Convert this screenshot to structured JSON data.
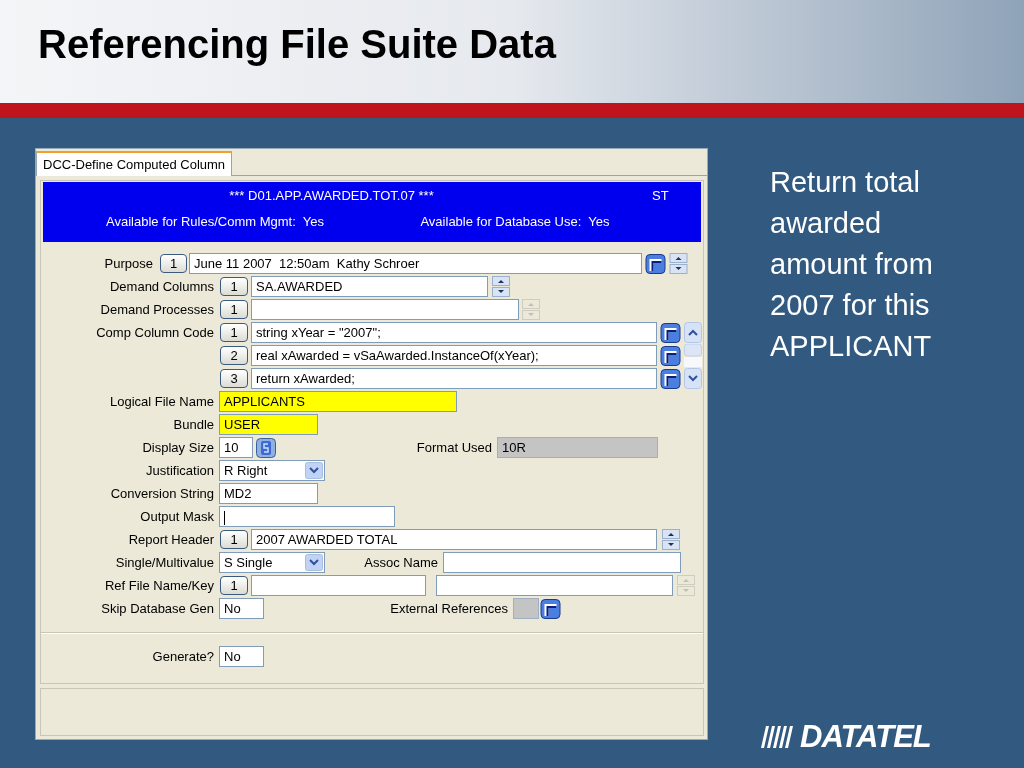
{
  "slide": {
    "title": "Referencing File Suite Data",
    "note": "Return total awarded amount from 2007 for this APPLICANT",
    "logo": "DATATEL"
  },
  "window": {
    "tabs": [
      {
        "label": "DCC-Define Computed Column",
        "selected": true
      }
    ],
    "header": {
      "record": "*** D01.APP.AWARDED.TOT.07 ***",
      "code": "ST",
      "rules": "Available for Rules/Comm Mgmt:  Yes",
      "database": "Available for Database Use:  Yes"
    },
    "rows": [
      {
        "parts": [
          {
            "kind": "label",
            "text": "Purpose"
          },
          {
            "kind": "index",
            "text": "1"
          },
          {
            "kind": "field",
            "value": "June 11 2007  12:50am  Kathy Schroer",
            "highlighted": false,
            "focused": false
          },
          {
            "kind": "lookup"
          },
          {
            "kind": "spinner",
            "disabled": false
          }
        ]
      },
      {
        "parts": [
          {
            "kind": "label",
            "text": "Demand Columns"
          },
          {
            "kind": "index",
            "text": "1"
          },
          {
            "kind": "field",
            "value": "SA.AWARDED",
            "highlighted": false,
            "focused": false
          },
          {
            "kind": "spinner",
            "disabled": false
          }
        ]
      },
      {
        "parts": [
          {
            "kind": "label",
            "text": "Demand Processes"
          },
          {
            "kind": "index",
            "text": "1"
          },
          {
            "kind": "field",
            "highlighted": false,
            "focused": false
          },
          {
            "kind": "spinner",
            "disabled": true
          }
        ]
      },
      {
        "parts": [
          {
            "kind": "label",
            "text": "Comp Column Code"
          },
          {
            "kind": "index",
            "text": "1"
          },
          {
            "kind": "field",
            "value": "string xYear = \"2007\";",
            "highlighted": false,
            "focused": false
          },
          {
            "kind": "lookup"
          },
          {
            "kind": "scroll-up"
          }
        ]
      },
      {
        "parts": [
          {
            "kind": "index",
            "text": "2"
          },
          {
            "kind": "field",
            "value": "real xAwarded = vSaAwarded.InstanceOf(xYear);",
            "highlighted": false,
            "focused": false
          },
          {
            "kind": "lookup"
          },
          {
            "kind": "scroll-track"
          }
        ]
      },
      {
        "parts": [
          {
            "kind": "index",
            "text": "3"
          },
          {
            "kind": "field",
            "value": "return xAwarded;",
            "highlighted": false,
            "focused": false
          },
          {
            "kind": "lookup"
          },
          {
            "kind": "scroll-down"
          }
        ]
      },
      {
        "parts": [
          {
            "kind": "label",
            "text": "Logical File Name"
          },
          {
            "kind": "field",
            "value": "APPLICANTS",
            "highlighted": true,
            "focused": false
          }
        ]
      },
      {
        "parts": [
          {
            "kind": "label",
            "text": "Bundle"
          },
          {
            "kind": "field",
            "value": "USER",
            "highlighted": true,
            "focused": false
          }
        ]
      },
      {
        "parts": [
          {
            "kind": "label",
            "text": "Display Size"
          },
          {
            "kind": "field",
            "value": "10",
            "highlighted": false,
            "focused": false
          },
          {
            "kind": "size-picker"
          },
          {
            "kind": "label",
            "text": "Format Used"
          },
          {
            "kind": "readonly",
            "value": "10R"
          }
        ]
      },
      {
        "parts": [
          {
            "kind": "label",
            "text": "Justification"
          },
          {
            "kind": "select",
            "value": "R Right"
          }
        ]
      },
      {
        "parts": [
          {
            "kind": "label",
            "text": "Conversion String"
          },
          {
            "kind": "field",
            "value": "MD2",
            "highlighted": false,
            "focused": false
          }
        ]
      },
      {
        "parts": [
          {
            "kind": "label",
            "text": "Output Mask"
          },
          {
            "kind": "field",
            "highlighted": false,
            "focused": true
          }
        ]
      },
      {
        "parts": [
          {
            "kind": "label",
            "text": "Report Header"
          },
          {
            "kind": "index",
            "text": "1"
          },
          {
            "kind": "field",
            "value": "2007 AWARDED TOTAL",
            "highlighted": false,
            "focused": false
          },
          {
            "kind": "spinner",
            "disabled": false
          }
        ]
      },
      {
        "parts": [
          {
            "kind": "label",
            "text": "Single/Multivalue"
          },
          {
            "kind": "select",
            "value": "S Single"
          },
          {
            "kind": "label",
            "text": "Assoc Name"
          },
          {
            "kind": "field",
            "highlighted": false,
            "focused": false
          }
        ]
      },
      {
        "parts": [
          {
            "kind": "label",
            "text": "Ref File Name/Key"
          },
          {
            "kind": "index",
            "text": "1"
          },
          {
            "kind": "field",
            "highlighted": false,
            "focused": false
          },
          {
            "kind": "field",
            "highlighted": false,
            "focused": false
          },
          {
            "kind": "spinner",
            "disabled": true
          }
        ]
      },
      {
        "parts": [
          {
            "kind": "label",
            "text": "Skip Database Gen"
          },
          {
            "kind": "field",
            "value": "No",
            "highlighted": false,
            "focused": false
          },
          {
            "kind": "label",
            "text": "External References"
          },
          {
            "kind": "readonly"
          },
          {
            "kind": "lookup"
          }
        ]
      }
    ],
    "generate": {
      "label": "Generate?",
      "value": "No"
    }
  }
}
